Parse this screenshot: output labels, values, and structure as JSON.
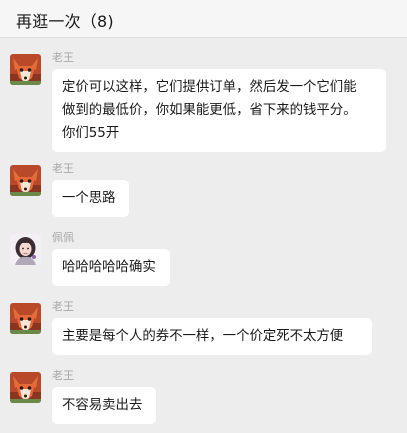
{
  "header": {
    "title": "再逛一次（8)"
  },
  "messages": [
    {
      "sender": "老王",
      "avatar_icon": "fox-avatar-icon",
      "lines": [
        "定价可以这样，它们提供订单，然后发一个它们能",
        "做到的最低价，你如果能更低，省下来的钱平分。",
        "你们55开"
      ]
    },
    {
      "sender": "老王",
      "avatar_icon": "fox-avatar-icon",
      "lines": [
        "一个思路"
      ]
    },
    {
      "sender": "佩佩",
      "avatar_icon": "girl-avatar-icon",
      "lines": [
        "哈哈哈哈哈确实"
      ]
    },
    {
      "sender": "老王",
      "avatar_icon": "fox-avatar-icon",
      "lines": [
        "主要是每个人的券不一样，一个价定死不太方便"
      ]
    },
    {
      "sender": "老王",
      "avatar_icon": "fox-avatar-icon",
      "lines": [
        "不容易卖出去"
      ]
    }
  ],
  "colors": {
    "background": "#ededed",
    "bubble": "#ffffff",
    "sender_name": "#a8a8a8",
    "fox_orange": "#d9552a"
  }
}
